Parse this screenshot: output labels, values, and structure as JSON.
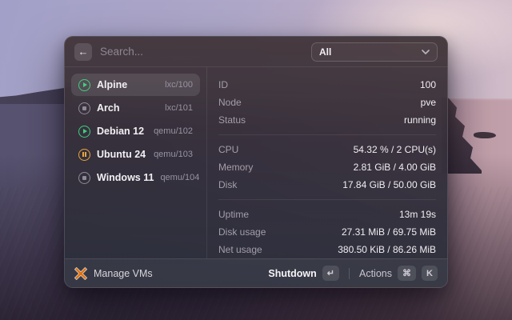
{
  "search": {
    "placeholder": "Search..."
  },
  "filter": {
    "value": "All"
  },
  "vms": [
    {
      "name": "Alpine",
      "id": "lxc/100",
      "state": "running",
      "selected": true
    },
    {
      "name": "Arch",
      "id": "lxc/101",
      "state": "stopped",
      "selected": false
    },
    {
      "name": "Debian 12",
      "id": "qemu/102",
      "state": "running",
      "selected": false
    },
    {
      "name": "Ubuntu 24",
      "id": "qemu/103",
      "state": "paused",
      "selected": false
    },
    {
      "name": "Windows 11",
      "id": "qemu/104",
      "state": "stopped",
      "selected": false
    }
  ],
  "details": {
    "sections": [
      {
        "rows": [
          {
            "label": "ID",
            "value": "100"
          },
          {
            "label": "Node",
            "value": "pve"
          },
          {
            "label": "Status",
            "value": "running"
          }
        ]
      },
      {
        "rows": [
          {
            "label": "CPU",
            "value": "54.32 % / 2 CPU(s)"
          },
          {
            "label": "Memory",
            "value": "2.81 GiB / 4.00 GiB"
          },
          {
            "label": "Disk",
            "value": "17.84 GiB / 50.00 GiB"
          }
        ]
      },
      {
        "rows": [
          {
            "label": "Uptime",
            "value": "13m 19s"
          },
          {
            "label": "Disk usage",
            "value": "27.31 MiB / 69.75 MiB"
          },
          {
            "label": "Net usage",
            "value": "380.50 KiB / 86.26 MiB"
          }
        ]
      }
    ]
  },
  "footer": {
    "app_label": "Manage VMs",
    "primary_action": "Shutdown",
    "primary_key": "↵",
    "actions_label": "Actions",
    "actions_keys": [
      "⌘",
      "K"
    ]
  },
  "colors": {
    "accent_orange": "#e57000",
    "state_running": "#3ecf7f",
    "state_paused": "#e8a33d",
    "state_stopped": "#8f8b99"
  }
}
